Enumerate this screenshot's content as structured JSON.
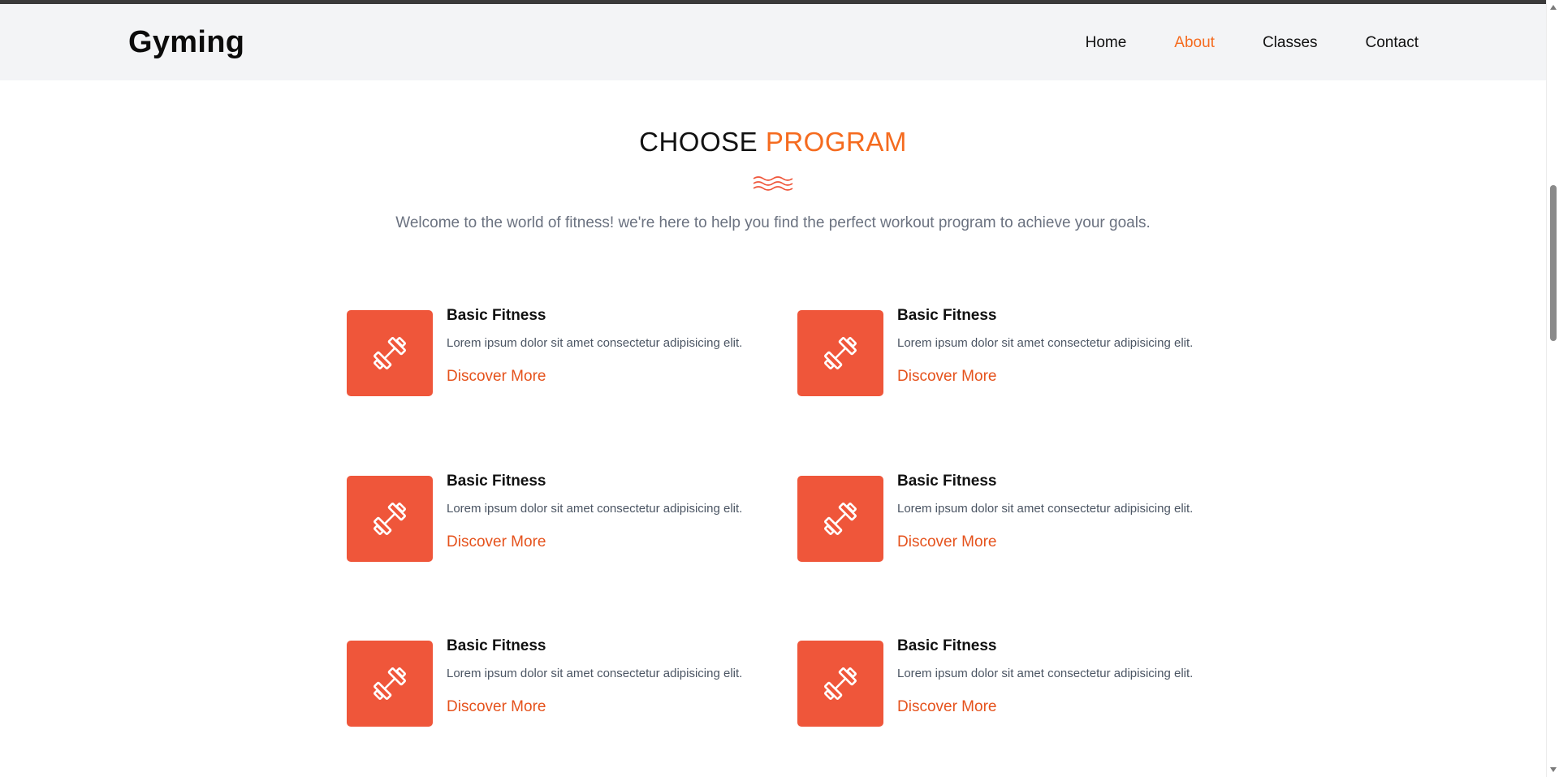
{
  "header": {
    "logo": "Gyming",
    "nav": [
      {
        "label": "Home",
        "active": false
      },
      {
        "label": "About",
        "active": true
      },
      {
        "label": "Classes",
        "active": false
      },
      {
        "label": "Contact",
        "active": false
      }
    ]
  },
  "section": {
    "heading_part1": "CHOOSE ",
    "heading_part2": "PROGRAM",
    "subtitle": "Welcome to the world of fitness! we're here to help you find the perfect workout program to achieve your goals.",
    "divider_icon": "wave-lines-icon"
  },
  "programs": [
    {
      "icon": "dumbbell-icon",
      "title": "Basic Fitness",
      "description": "Lorem ipsum dolor sit amet consectetur adipisicing elit.",
      "link": "Discover More"
    },
    {
      "icon": "dumbbell-icon",
      "title": "Basic Fitness",
      "description": "Lorem ipsum dolor sit amet consectetur adipisicing elit.",
      "link": "Discover More"
    },
    {
      "icon": "dumbbell-icon",
      "title": "Basic Fitness",
      "description": "Lorem ipsum dolor sit amet consectetur adipisicing elit.",
      "link": "Discover More"
    },
    {
      "icon": "dumbbell-icon",
      "title": "Basic Fitness",
      "description": "Lorem ipsum dolor sit amet consectetur adipisicing elit.",
      "link": "Discover More"
    },
    {
      "icon": "dumbbell-icon",
      "title": "Basic Fitness",
      "description": "Lorem ipsum dolor sit amet consectetur adipisicing elit.",
      "link": "Discover More"
    },
    {
      "icon": "dumbbell-icon",
      "title": "Basic Fitness",
      "description": "Lorem ipsum dolor sit amet consectetur adipisicing elit.",
      "link": "Discover More"
    }
  ],
  "colors": {
    "accent": "#f56b1f",
    "icon_bg": "#ef563a",
    "link": "#e5521c",
    "navbar_bg": "#f3f4f6",
    "muted_text": "#6b7280"
  }
}
